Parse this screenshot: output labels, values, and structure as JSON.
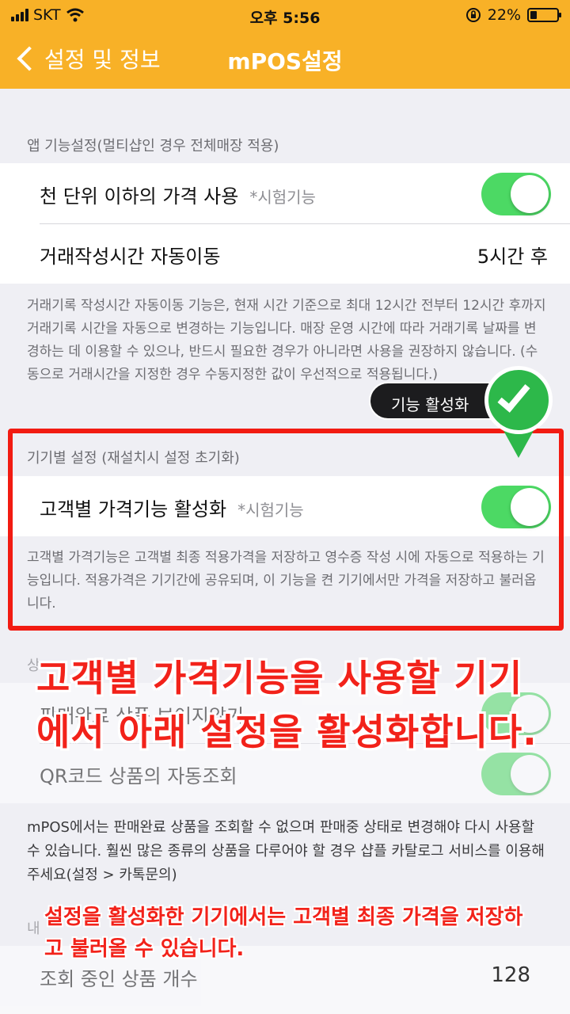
{
  "status": {
    "carrier": "SKT",
    "time": "오후 5:56",
    "battery": "22%",
    "battery_level": 0.22
  },
  "nav": {
    "back_label": "설정 및 정보",
    "title": "mPOS설정"
  },
  "app_section": {
    "header": "앱 기능설정(멀티샵인 경우 전체매장 적용)",
    "row1_label": "천 단위 이하의 가격 사용",
    "row1_sub": "*시험기능",
    "row2_label": "거래작성시간 자동이동",
    "row2_value": "5시간 후",
    "footer": "거래기록 작성시간 자동이동 기능은, 현재 시간 기준으로 최대 12시간 전부터 12시간 후까지 거래기록 시간을 자동으로 변경하는 기능입니다. 매장 운영 시간에 따라 거래기록 날짜를 변경하는 데 이용할 수 있으나, 반드시 필요한 경우가 아니라면 사용을 권장하지 않습니다. (수동으로 거래시간을 지정한 경우 수동지정한 값이 우선적으로 적용됩니다.)"
  },
  "device_section": {
    "header": "기기별 설정 (재설치시 설정 초기화)",
    "row_label": "고객별 가격기능 활성화",
    "row_sub": "*시험기능",
    "footer": "고객별 가격기능은 고객별 최종 적용가격을 저장하고 영수증 작성 시에 자동으로 적용하는 기능입니다. 적용가격은 기기간에 공유되며, 이 기능을 켠 기기에서만 가격을 저장하고 불러옵니다."
  },
  "tooltip": {
    "label": "기능 활성화"
  },
  "product_section": {
    "header": "상",
    "row1_label": "판매완료 상품 보이지않기",
    "row2_label": "QR코드 상품의 자동조회",
    "footer": "mPOS에서는 판매완료 상품을 조회할 수 없으며 판매중 상태로 변경해야 다시 사용할 수 있습니다. 훨씬 많은 종류의 상품을 다루어야 할 경우 샵플 카탈로그 서비스를 이용해 주세요(설정 > 카톡문의)",
    "header2": "내",
    "row3_label": "조회 중인 상품 개수",
    "row3_value": "128"
  },
  "captions": {
    "big": "고객별 가격기능을 사용할 기기에서 아래 설정을 활성화합니다.",
    "small": "설정을 활성화한 기기에서는 고객별 최종 가격을 저장하고 불러올 수 있습니다."
  },
  "colors": {
    "nav": "#f8b127",
    "toggle_on": "#4cd964",
    "highlight": "#f21b12",
    "pin": "#2db84a"
  }
}
